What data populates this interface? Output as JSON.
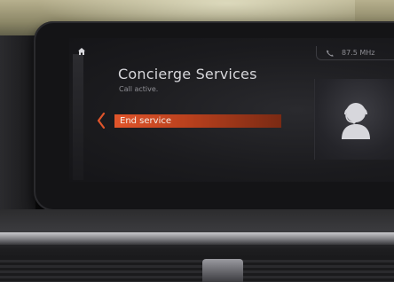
{
  "header": {
    "home_icon": "home-icon",
    "phone_icon": "phone-icon",
    "frequency": "87.5 MHz"
  },
  "page": {
    "title": "Concierge Services",
    "status": "Call active."
  },
  "menu": {
    "back_icon": "chevron-left-icon",
    "items": [
      {
        "label": "End service",
        "selected": true
      }
    ]
  },
  "contact": {
    "avatar_icon": "person-headset-icon"
  },
  "colors": {
    "accent": "#e0552b",
    "text_primary": "#d6d6da",
    "text_secondary": "#8f8f95"
  }
}
